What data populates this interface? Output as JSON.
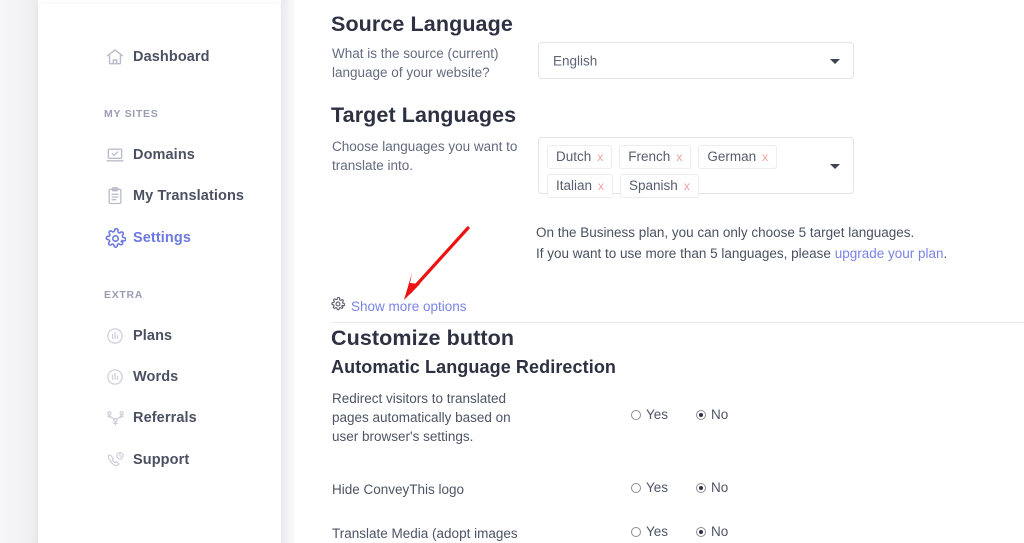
{
  "sidebar": {
    "items": [
      {
        "label": "Dashboard",
        "icon": "home-icon",
        "active": false
      },
      {
        "label": "Domains",
        "icon": "laptop-check-icon",
        "active": false
      },
      {
        "label": "My Translations",
        "icon": "clipboard-icon",
        "active": false
      },
      {
        "label": "Settings",
        "icon": "gear-icon",
        "active": true
      },
      {
        "label": "Plans",
        "icon": "chart-circle-icon",
        "active": false
      },
      {
        "label": "Words",
        "icon": "chart-circle-icon",
        "active": false
      },
      {
        "label": "Referrals",
        "icon": "network-people-icon",
        "active": false
      },
      {
        "label": "Support",
        "icon": "phone-headset-icon",
        "active": false
      }
    ],
    "sections": {
      "my_sites": "MY SITES",
      "extra": "EXTRA"
    }
  },
  "source_language": {
    "heading": "Source Language",
    "description": "What is the source (current) language of your website?",
    "selected": "English"
  },
  "target_languages": {
    "heading": "Target Languages",
    "description": "Choose languages you want to translate into.",
    "tags": [
      "Dutch",
      "French",
      "German",
      "Italian",
      "Spanish"
    ],
    "remove_glyph": "x"
  },
  "plan_note": {
    "line1": "On the Business plan, you can only choose 5 target languages.",
    "line2_prefix": "If you want to use more than 5 languages, please ",
    "link_text": "upgrade your plan",
    "line2_suffix": "."
  },
  "show_more": {
    "label": "Show more options",
    "icon": "gear-icon"
  },
  "customize": {
    "heading": "Customize button",
    "subheading": "Automatic Language Redirection"
  },
  "options": [
    {
      "label": "Redirect visitors to translated pages automatically based on user browser's settings.",
      "yes": "Yes",
      "no": "No",
      "value": "No"
    },
    {
      "label": "Hide ConveyThis logo",
      "yes": "Yes",
      "no": "No",
      "value": "No"
    },
    {
      "label": "Translate Media (adopt images",
      "yes": "Yes",
      "no": "No",
      "value": "No"
    }
  ],
  "annotation": {
    "type": "arrow",
    "color": "#ee1111",
    "points_to": "Show more options"
  },
  "colors": {
    "accent": "#6c7ae0",
    "link": "#7a83e8",
    "heading": "#2d3142",
    "body_text": "#4d5464",
    "muted": "#9a9db2",
    "tag_remove": "#f2a0a0",
    "annotation_red": "#ee1111"
  }
}
